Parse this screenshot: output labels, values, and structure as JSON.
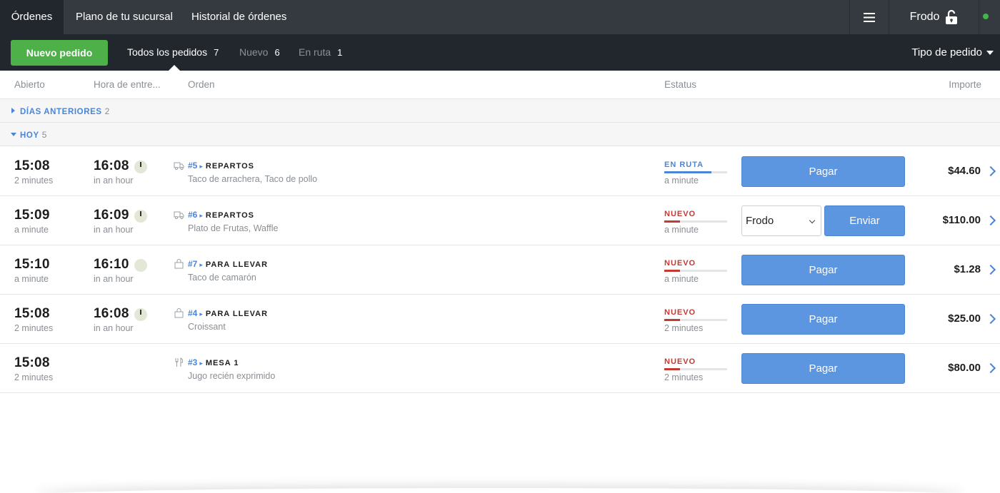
{
  "nav": {
    "tabs": [
      {
        "label": "Órdenes",
        "active": true
      },
      {
        "label": "Plano de tu sucursal"
      },
      {
        "label": "Historial de órdenes"
      }
    ],
    "menu_icon": "hamburger-icon",
    "user": "Frodo",
    "lock_icon": "unlocked-padlock-icon",
    "status_color": "#44b548"
  },
  "subbar": {
    "new_order_label": "Nuevo pedido",
    "filters": [
      {
        "label": "Todos los pedidos",
        "count": "7",
        "active": true
      },
      {
        "label": "Nuevo",
        "count": "6"
      },
      {
        "label": "En ruta",
        "count": "1"
      }
    ],
    "order_type_label": "Tipo de pedido"
  },
  "columns": {
    "open": "Abierto",
    "delivery": "Hora de entre...",
    "order": "Orden",
    "status": "Estatus",
    "amount": "Importe"
  },
  "groups": {
    "previous": {
      "label": "DÍAS ANTERIORES",
      "count": "2"
    },
    "today": {
      "label": "HOY",
      "count": "5"
    }
  },
  "orders": [
    {
      "open_time": "15:08",
      "open_ago": "2 minutes",
      "delivery_time": "16:08",
      "delivery_rel": "in an hour",
      "number": "#5",
      "type": "REPARTOS",
      "type_icon": "delivery-truck-icon",
      "items": "Taco de arrachera, Taco de pollo",
      "status": "EN RUTA",
      "status_ago": "a minute",
      "status_progress": 0.75,
      "action": "Pagar",
      "amount": "$44.60"
    },
    {
      "open_time": "15:09",
      "open_ago": "a minute",
      "delivery_time": "16:09",
      "delivery_rel": "in an hour",
      "number": "#6",
      "type": "REPARTOS",
      "type_icon": "delivery-truck-icon",
      "items": "Plato de Frutas, Waffle",
      "status": "NUEVO",
      "status_ago": "a minute",
      "status_progress": 0.25,
      "driver_select": "Frodo",
      "action": "Enviar",
      "amount": "$110.00"
    },
    {
      "open_time": "15:10",
      "open_ago": "a minute",
      "delivery_time": "16:10",
      "delivery_rel": "in an hour",
      "number": "#7",
      "type": "PARA LLEVAR",
      "type_icon": "takeout-bag-icon",
      "items": "Taco de camarón",
      "status": "NUEVO",
      "status_ago": "a minute",
      "status_progress": 0.25,
      "action": "Pagar",
      "amount": "$1.28"
    },
    {
      "open_time": "15:08",
      "open_ago": "2 minutes",
      "delivery_time": "16:08",
      "delivery_rel": "in an hour",
      "number": "#4",
      "type": "PARA LLEVAR",
      "type_icon": "takeout-bag-icon",
      "items": "Croissant",
      "status": "NUEVO",
      "status_ago": "2 minutes",
      "status_progress": 0.25,
      "action": "Pagar",
      "amount": "$25.00"
    },
    {
      "open_time": "15:08",
      "open_ago": "2 minutes",
      "number": "#3",
      "type": "MESA 1",
      "type_icon": "fork-knife-icon",
      "items": "Jugo recién exprimido",
      "status": "NUEVO",
      "status_ago": "2 minutes",
      "status_progress": 0.25,
      "action": "Pagar",
      "amount": "$80.00"
    }
  ]
}
